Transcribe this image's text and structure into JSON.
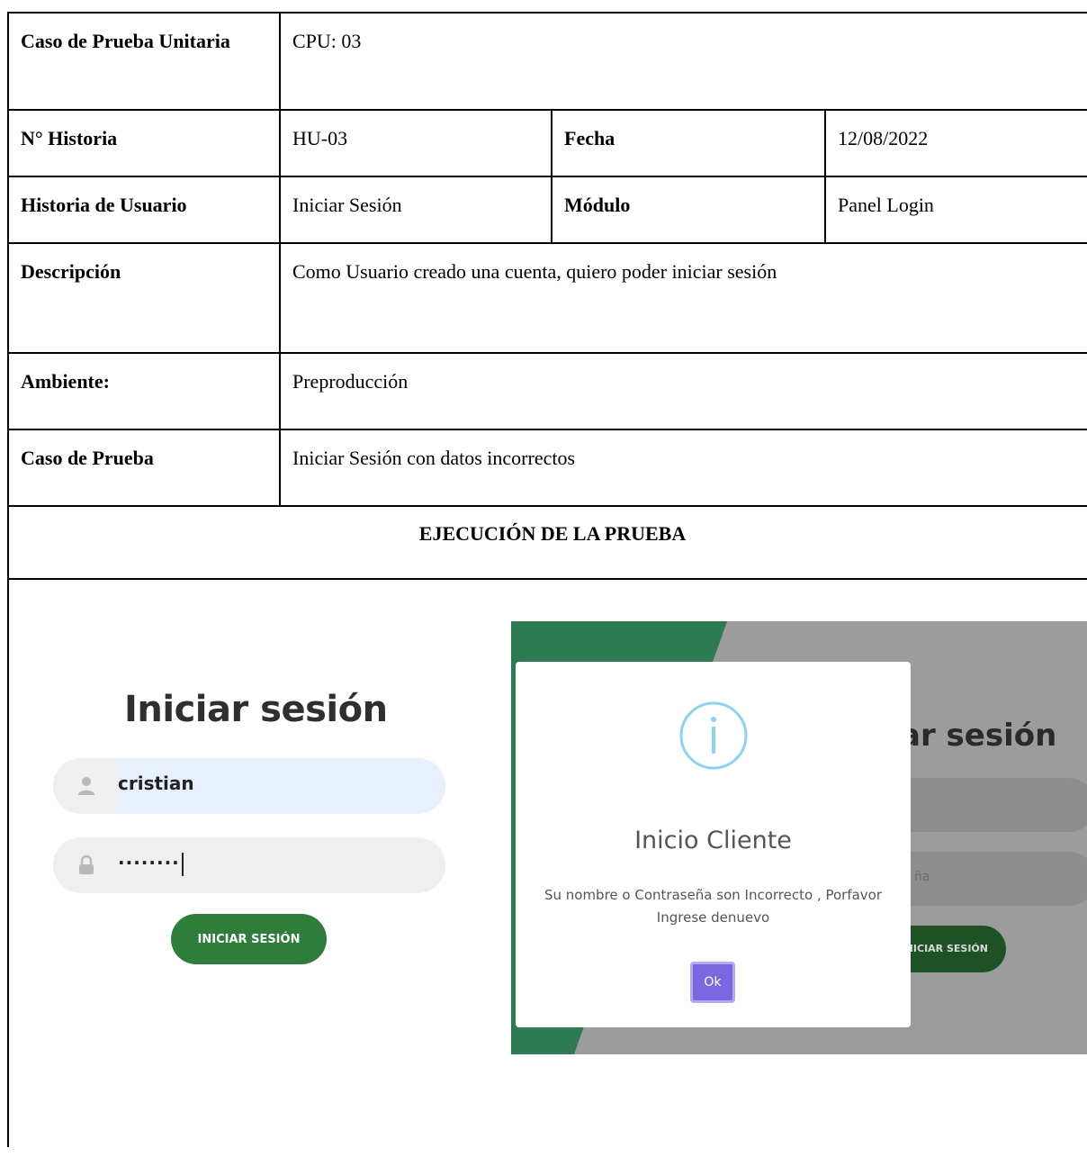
{
  "document": {
    "rows": {
      "title": {
        "label": "Caso de Prueba Unitaria",
        "value": "CPU: 03"
      },
      "history": {
        "label": "N° Historia",
        "value": "HU-03",
        "date_label": "Fecha",
        "date_value": "12/08/2022"
      },
      "user_story": {
        "label": "Historia de Usuario",
        "value": "Iniciar Sesión",
        "module_label": "Módulo",
        "module_value": "Panel Login"
      },
      "description": {
        "label": "Descripción",
        "value": "Como Usuario creado una cuenta, quiero poder iniciar sesión"
      },
      "environment": {
        "label": "Ambiente:",
        "value": "Preproducción"
      },
      "test_case": {
        "label": "Caso de Prueba",
        "value": "Iniciar Sesión con datos incorrectos"
      },
      "execution": {
        "heading": "EJECUCIÓN DE LA PRUEBA"
      }
    }
  },
  "login_form": {
    "title": "Iniciar sesión",
    "username_value": "cristian",
    "password_value": "········",
    "submit_label": "INICIAR SESIÓN",
    "icons": {
      "user": "user-icon",
      "lock": "lock-icon"
    },
    "colors": {
      "button": "#2f7d3a",
      "autofill": "#e8f0fe"
    }
  },
  "modal_screenshot": {
    "background_title": "ar sesión",
    "background_password_hint": "ña",
    "background_button": "NICIAR SESIÓN",
    "dialog": {
      "icon": "info-icon",
      "title": "Inicio Cliente",
      "message": "Su nombre o Contraseña son Incorrecto , Porfavor Ingrese denuevo",
      "ok_label": "Ok"
    },
    "colors": {
      "overlay": "#9c9c9c",
      "ok_button": "#7b67df",
      "info_ring": "#89d4f0",
      "green": "#2e7a52"
    }
  }
}
